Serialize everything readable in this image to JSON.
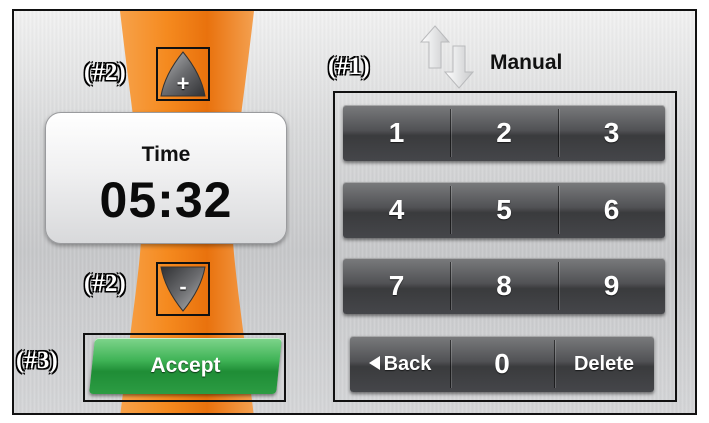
{
  "stepper": {
    "increment_label": "+",
    "decrement_label": "-"
  },
  "time_display": {
    "label": "Time",
    "value": "05:32"
  },
  "accept_button": {
    "label": "Accept"
  },
  "mode": {
    "label": "Manual",
    "icon": "up-down-arrows-icon"
  },
  "keypad": {
    "rows": [
      [
        "1",
        "2",
        "3"
      ],
      [
        "4",
        "5",
        "6"
      ],
      [
        "7",
        "8",
        "9"
      ]
    ],
    "back_label": "Back",
    "zero_label": "0",
    "delete_label": "Delete"
  },
  "callouts": {
    "keypad": "(#1)",
    "increment": "(#2)",
    "decrement": "(#2)",
    "accept": "(#3)"
  },
  "colors": {
    "accent_orange": "#f58a1f",
    "accept_green": "#2ea447",
    "key_gray": "#4b4c4f"
  }
}
